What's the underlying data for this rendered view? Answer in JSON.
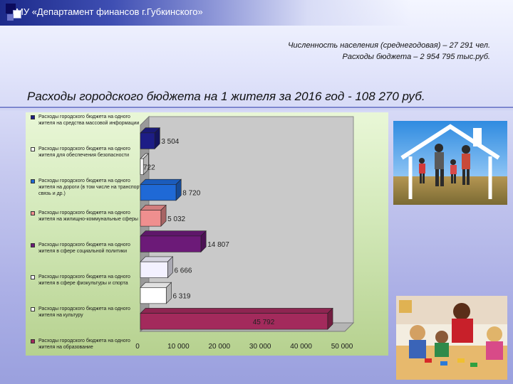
{
  "header": {
    "org": "МУ «Департамент финансов г.Губкинского»",
    "population_line": "Численность населения (среднегодовая) – 27 291 чел.",
    "budget_line": "Расходы бюджета – 2 954 795 тыс.руб."
  },
  "title": "Расходы городского бюджета на 1 жителя за 2016 год  - 108 270 руб.",
  "legend": [
    {
      "label": "Расходы городского бюджета на одного жителя на средства массовой информации",
      "color": "#1d1d86"
    },
    {
      "label": "Расходы городского бюджета на одного жителя для обеспечения безопасности",
      "color": "#ffffff"
    },
    {
      "label": "Расходы городского бюджета на одного жителя на дороги (в том числе на транспорт, связь и др.)",
      "color": "#1f69d6"
    },
    {
      "label": "Расходы городского бюджета на одного жителя на жилищно-коммунальные сферы",
      "color": "#ef8f8f"
    },
    {
      "label": "Расходы городского бюджета на одного жителя в сфере социальной политики",
      "color": "#6c1a78"
    },
    {
      "label": "Расходы городского бюджета на одного жителя в сфере физкультуры и спорта",
      "color": "#f3f1ff"
    },
    {
      "label": "Расходы городского бюджета на одного жителя на культуру",
      "color": "#ffffff"
    },
    {
      "label": "Расходы городского бюджета на одного жителя на образование",
      "color": "#a32a5c"
    }
  ],
  "chart_data": {
    "type": "bar",
    "orientation": "horizontal",
    "style": "3d",
    "series": [
      {
        "name": "Расходы городского бюджета на одного жителя на средства массовой информации",
        "value": 3504,
        "label": "3 504",
        "color": "#1d1d86"
      },
      {
        "name": "Расходы городского бюджета на одного жителя для обеспечения безопасности",
        "value": 722,
        "label": "722",
        "color": "#ffffff"
      },
      {
        "name": "Расходы городского бюджета на одного жителя на дороги (в том числе на транспорт, связь и др.)",
        "value": 8720,
        "label": "8 720",
        "color": "#1f69d6"
      },
      {
        "name": "Расходы городского бюджета на одного жителя на жилищно-коммунальные сферы",
        "value": 5032,
        "label": "5 032",
        "color": "#ef8f8f"
      },
      {
        "name": "Расходы городского бюджета на одного жителя в сфере социальной политики",
        "value": 14807,
        "label": "14 807",
        "color": "#6c1a78"
      },
      {
        "name": "Расходы городского бюджета на одного жителя в сфере физкультуры и спорта",
        "value": 6666,
        "label": "6 666",
        "color": "#f3f1ff"
      },
      {
        "name": "Расходы городского бюджета на одного жителя на культуру",
        "value": 6319,
        "label": "6 319",
        "color": "#ffffff"
      },
      {
        "name": "Расходы городского бюджета на одного жителя на образование",
        "value": 45792,
        "label": "45 792",
        "color": "#a32a5c"
      }
    ],
    "xlim": [
      0,
      50000
    ],
    "xticks": [
      "0",
      "10 000",
      "20 000",
      "30 000",
      "40 000",
      "50 000"
    ],
    "grid": false,
    "legend": "left"
  }
}
